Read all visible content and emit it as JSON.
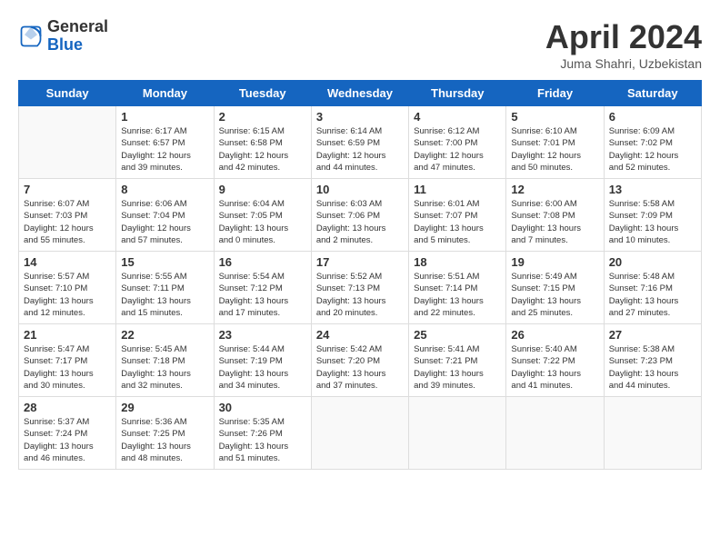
{
  "header": {
    "logo_general": "General",
    "logo_blue": "Blue",
    "title": "April 2024",
    "subtitle": "Juma Shahri, Uzbekistan"
  },
  "days_of_week": [
    "Sunday",
    "Monday",
    "Tuesday",
    "Wednesday",
    "Thursday",
    "Friday",
    "Saturday"
  ],
  "weeks": [
    [
      {
        "day": "",
        "info": ""
      },
      {
        "day": "1",
        "info": "Sunrise: 6:17 AM\nSunset: 6:57 PM\nDaylight: 12 hours\nand 39 minutes."
      },
      {
        "day": "2",
        "info": "Sunrise: 6:15 AM\nSunset: 6:58 PM\nDaylight: 12 hours\nand 42 minutes."
      },
      {
        "day": "3",
        "info": "Sunrise: 6:14 AM\nSunset: 6:59 PM\nDaylight: 12 hours\nand 44 minutes."
      },
      {
        "day": "4",
        "info": "Sunrise: 6:12 AM\nSunset: 7:00 PM\nDaylight: 12 hours\nand 47 minutes."
      },
      {
        "day": "5",
        "info": "Sunrise: 6:10 AM\nSunset: 7:01 PM\nDaylight: 12 hours\nand 50 minutes."
      },
      {
        "day": "6",
        "info": "Sunrise: 6:09 AM\nSunset: 7:02 PM\nDaylight: 12 hours\nand 52 minutes."
      }
    ],
    [
      {
        "day": "7",
        "info": "Sunrise: 6:07 AM\nSunset: 7:03 PM\nDaylight: 12 hours\nand 55 minutes."
      },
      {
        "day": "8",
        "info": "Sunrise: 6:06 AM\nSunset: 7:04 PM\nDaylight: 12 hours\nand 57 minutes."
      },
      {
        "day": "9",
        "info": "Sunrise: 6:04 AM\nSunset: 7:05 PM\nDaylight: 13 hours\nand 0 minutes."
      },
      {
        "day": "10",
        "info": "Sunrise: 6:03 AM\nSunset: 7:06 PM\nDaylight: 13 hours\nand 2 minutes."
      },
      {
        "day": "11",
        "info": "Sunrise: 6:01 AM\nSunset: 7:07 PM\nDaylight: 13 hours\nand 5 minutes."
      },
      {
        "day": "12",
        "info": "Sunrise: 6:00 AM\nSunset: 7:08 PM\nDaylight: 13 hours\nand 7 minutes."
      },
      {
        "day": "13",
        "info": "Sunrise: 5:58 AM\nSunset: 7:09 PM\nDaylight: 13 hours\nand 10 minutes."
      }
    ],
    [
      {
        "day": "14",
        "info": "Sunrise: 5:57 AM\nSunset: 7:10 PM\nDaylight: 13 hours\nand 12 minutes."
      },
      {
        "day": "15",
        "info": "Sunrise: 5:55 AM\nSunset: 7:11 PM\nDaylight: 13 hours\nand 15 minutes."
      },
      {
        "day": "16",
        "info": "Sunrise: 5:54 AM\nSunset: 7:12 PM\nDaylight: 13 hours\nand 17 minutes."
      },
      {
        "day": "17",
        "info": "Sunrise: 5:52 AM\nSunset: 7:13 PM\nDaylight: 13 hours\nand 20 minutes."
      },
      {
        "day": "18",
        "info": "Sunrise: 5:51 AM\nSunset: 7:14 PM\nDaylight: 13 hours\nand 22 minutes."
      },
      {
        "day": "19",
        "info": "Sunrise: 5:49 AM\nSunset: 7:15 PM\nDaylight: 13 hours\nand 25 minutes."
      },
      {
        "day": "20",
        "info": "Sunrise: 5:48 AM\nSunset: 7:16 PM\nDaylight: 13 hours\nand 27 minutes."
      }
    ],
    [
      {
        "day": "21",
        "info": "Sunrise: 5:47 AM\nSunset: 7:17 PM\nDaylight: 13 hours\nand 30 minutes."
      },
      {
        "day": "22",
        "info": "Sunrise: 5:45 AM\nSunset: 7:18 PM\nDaylight: 13 hours\nand 32 minutes."
      },
      {
        "day": "23",
        "info": "Sunrise: 5:44 AM\nSunset: 7:19 PM\nDaylight: 13 hours\nand 34 minutes."
      },
      {
        "day": "24",
        "info": "Sunrise: 5:42 AM\nSunset: 7:20 PM\nDaylight: 13 hours\nand 37 minutes."
      },
      {
        "day": "25",
        "info": "Sunrise: 5:41 AM\nSunset: 7:21 PM\nDaylight: 13 hours\nand 39 minutes."
      },
      {
        "day": "26",
        "info": "Sunrise: 5:40 AM\nSunset: 7:22 PM\nDaylight: 13 hours\nand 41 minutes."
      },
      {
        "day": "27",
        "info": "Sunrise: 5:38 AM\nSunset: 7:23 PM\nDaylight: 13 hours\nand 44 minutes."
      }
    ],
    [
      {
        "day": "28",
        "info": "Sunrise: 5:37 AM\nSunset: 7:24 PM\nDaylight: 13 hours\nand 46 minutes."
      },
      {
        "day": "29",
        "info": "Sunrise: 5:36 AM\nSunset: 7:25 PM\nDaylight: 13 hours\nand 48 minutes."
      },
      {
        "day": "30",
        "info": "Sunrise: 5:35 AM\nSunset: 7:26 PM\nDaylight: 13 hours\nand 51 minutes."
      },
      {
        "day": "",
        "info": ""
      },
      {
        "day": "",
        "info": ""
      },
      {
        "day": "",
        "info": ""
      },
      {
        "day": "",
        "info": ""
      }
    ]
  ]
}
